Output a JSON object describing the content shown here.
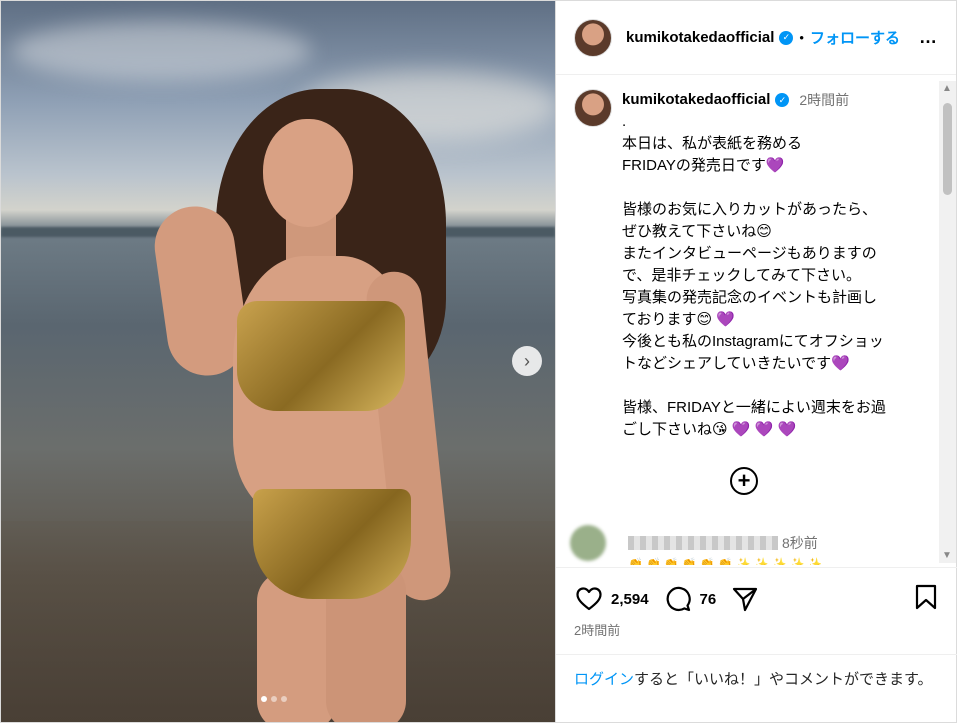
{
  "post": {
    "username": "kumikotakedaofficial",
    "follow_label": "フォローする",
    "separator": "•",
    "more_label": "…"
  },
  "caption": {
    "username": "kumikotakedaofficial",
    "time": "2時間前",
    "text": ".\n本日は、私が表紙を務める\nFRIDAYの発売日です💜\n\n皆様のお気に入りカットがあったら、\nぜひ教えて下さいね😊\nまたインタビューページもありますの\nで、是非チェックしてみて下さい。\n写真集の発売記念のイベントも計画し\nております😊 💜\n今後とも私のInstagramにてオフショッ\nトなどシェアしていきたいです💜\n\n皆様、FRIDAYと一緒によい週末をお過\nごし下さいね😘 💜 💜 💜"
  },
  "comment": {
    "time": "8秒前",
    "emoji_row": "👏👏👏👏👏👏✨✨✨✨✨"
  },
  "actions": {
    "likes": "2,594",
    "comments": "76",
    "posted_ago": "2時間前"
  },
  "login_prompt": {
    "link": "ログイン",
    "text": "すると「いいね！」やコメントができます。"
  },
  "carousel": {
    "next_icon": "chevron-right-icon",
    "total_slides": 3,
    "active_slide": 1
  },
  "colors": {
    "accent": "#0095f6",
    "muted": "#737373"
  }
}
